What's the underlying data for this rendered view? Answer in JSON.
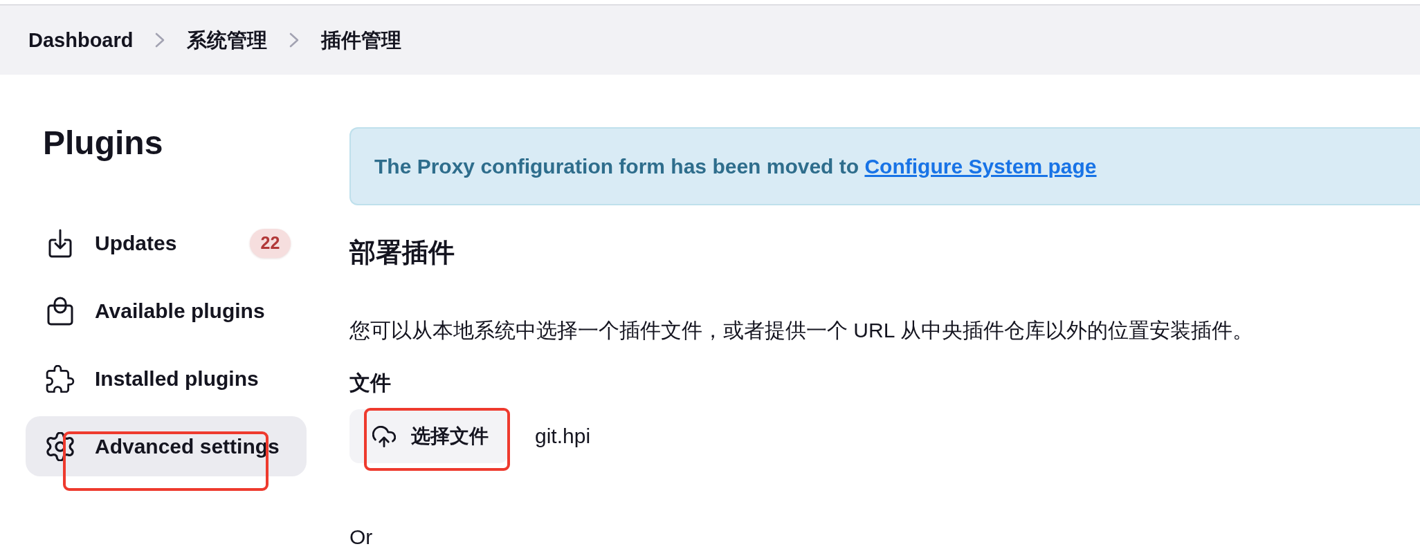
{
  "breadcrumbs": [
    {
      "label": "Dashboard"
    },
    {
      "label": "系统管理"
    },
    {
      "label": "插件管理"
    }
  ],
  "sidebar": {
    "title": "Plugins",
    "items": [
      {
        "label": "Updates",
        "badge": "22",
        "selected": false,
        "annotated": false
      },
      {
        "label": "Available plugins",
        "selected": false,
        "annotated": false
      },
      {
        "label": "Installed plugins",
        "selected": false,
        "annotated": false
      },
      {
        "label": "Advanced settings",
        "selected": true,
        "annotated": true
      }
    ]
  },
  "alert": {
    "text": "The Proxy configuration form has been moved to",
    "link": "Configure System page"
  },
  "section": {
    "heading": "部署插件",
    "description": "您可以从本地系统中选择一个插件文件，或者提供一个 URL 从中央插件仓库以外的位置安装插件。",
    "file_label": "文件",
    "file_upload": {
      "button": "选择文件",
      "file_name": "git.hpi",
      "annotated": true
    },
    "or_text": "Or"
  }
}
